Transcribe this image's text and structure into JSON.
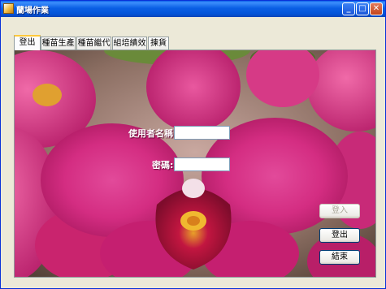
{
  "window": {
    "title": "蘭場作業"
  },
  "titlebar": {
    "min_glyph": "_",
    "max_glyph": "□",
    "close_glyph": "✕"
  },
  "tabs": [
    {
      "label": "登出",
      "active": true
    },
    {
      "label": "種苗生產",
      "active": false
    },
    {
      "label": "種苗繼代",
      "active": false
    },
    {
      "label": "組培績效",
      "active": false
    },
    {
      "label": "揀貨",
      "active": false
    }
  ],
  "login": {
    "username_label": "使用者名稱:",
    "username_value": "",
    "password_label": "密碼:",
    "password_value": ""
  },
  "buttons": {
    "login": "登入",
    "logout": "登出",
    "exit": "結束"
  },
  "colors": {
    "accent": "#0a5de8",
    "photo_main": "#d0287a"
  }
}
